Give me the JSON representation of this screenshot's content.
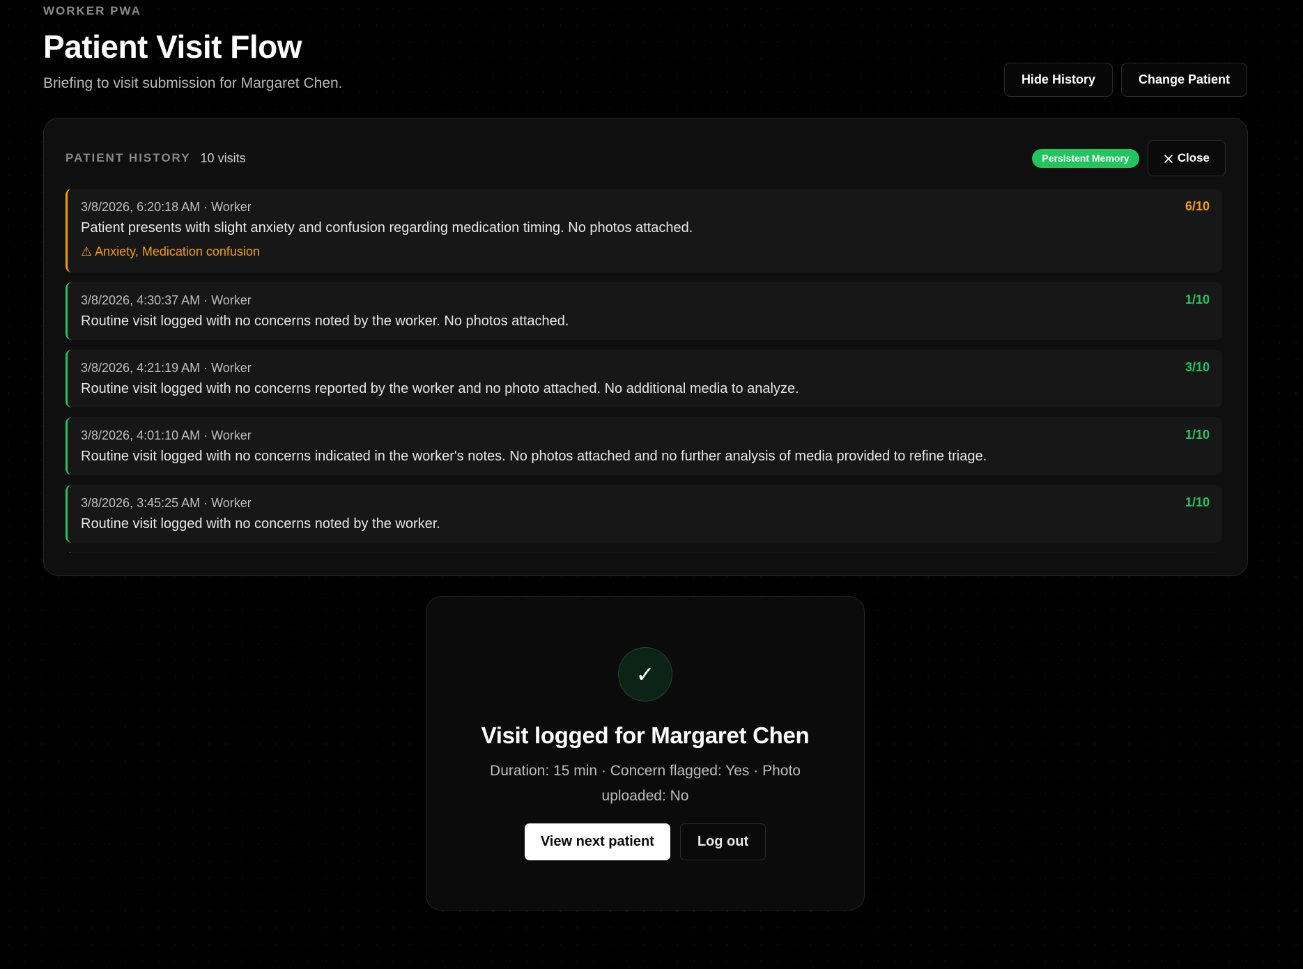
{
  "header": {
    "eyebrow": "WORKER PWA",
    "title": "Patient Visit Flow",
    "subtitle": "Briefing to visit submission for Margaret Chen.",
    "hide_history_label": "Hide History",
    "change_patient_label": "Change Patient"
  },
  "history": {
    "title": "PATIENT HISTORY",
    "count": "10 visits",
    "badge": "Persistent Memory",
    "close_label": "Close",
    "visits": [
      {
        "meta": "3/8/2026, 6:20:18 AM · Worker",
        "score": "6/10",
        "note": "Patient presents with slight anxiety and confusion regarding medication timing. No photos attached.",
        "flags": "⚠ Anxiety, Medication confusion"
      },
      {
        "meta": "3/8/2026, 4:30:37 AM · Worker",
        "score": "1/10",
        "note": "Routine visit logged with no concerns noted by the worker. No photos attached."
      },
      {
        "meta": "3/8/2026, 4:21:19 AM · Worker",
        "score": "3/10",
        "note": "Routine visit logged with no concerns reported by the worker and no photo attached. No additional media to analyze."
      },
      {
        "meta": "3/8/2026, 4:01:10 AM · Worker",
        "score": "1/10",
        "note": "Routine visit logged with no concerns indicated in the worker's notes. No photos attached and no further analysis of media provided to refine triage."
      },
      {
        "meta": "3/8/2026, 3:45:25 AM · Worker",
        "score": "1/10",
        "note": "Routine visit logged with no concerns noted by the worker."
      }
    ]
  },
  "completion": {
    "icon": "check-icon",
    "check_glyph": "✓",
    "title": "Visit logged for Margaret Chen",
    "summary": "Duration: 15 min · Concern flagged: Yes · Photo uploaded: No",
    "next_label": "View next patient",
    "logout_label": "Log out"
  },
  "colors": {
    "accent_green": "#22c55e",
    "warning_amber": "#f59e0b",
    "background": "#000000"
  }
}
